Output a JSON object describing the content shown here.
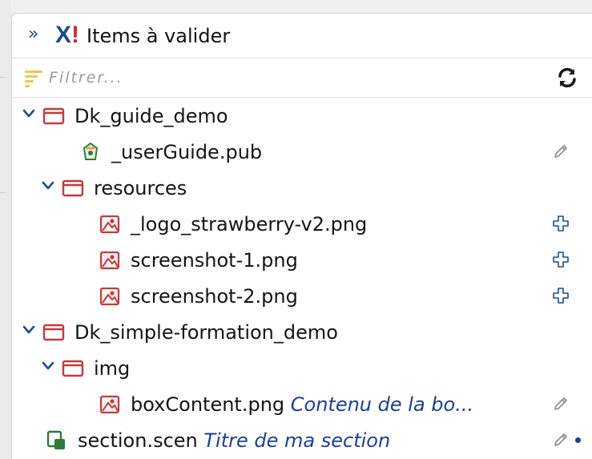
{
  "panel": {
    "collapse_icon": "»",
    "title": "Items à valider",
    "brand_icon": "x-exclamation-logo",
    "accent_color": "#1c4d8c",
    "alert_color": "#d7262f"
  },
  "filter": {
    "placeholder": "Filtrer...",
    "value": ""
  },
  "tree": [
    {
      "name": "Dk_guide_demo",
      "type": "folder",
      "expanded": true,
      "depth": 0
    },
    {
      "name": "_userGuide.pub",
      "type": "publication",
      "depth": 1,
      "action": "edit"
    },
    {
      "name": "resources",
      "type": "folder",
      "expanded": true,
      "depth": 1
    },
    {
      "name": "_logo_strawberry-v2.png",
      "type": "image",
      "depth": 2,
      "action": "add"
    },
    {
      "name": "screenshot-1.png",
      "type": "image",
      "depth": 2,
      "action": "add"
    },
    {
      "name": "screenshot-2.png",
      "type": "image",
      "depth": 2,
      "action": "add"
    },
    {
      "name": "Dk_simple-formation_demo",
      "type": "folder",
      "expanded": true,
      "depth": 0
    },
    {
      "name": "img",
      "type": "folder",
      "expanded": true,
      "depth": 1
    },
    {
      "name": "boxContent.png",
      "description": "Contenu de la bo...",
      "type": "image",
      "depth": 2,
      "action": "edit"
    },
    {
      "name": "section.scen",
      "description": "Titre de ma section",
      "type": "section",
      "depth": 0,
      "action": "edit",
      "modified": true
    }
  ]
}
